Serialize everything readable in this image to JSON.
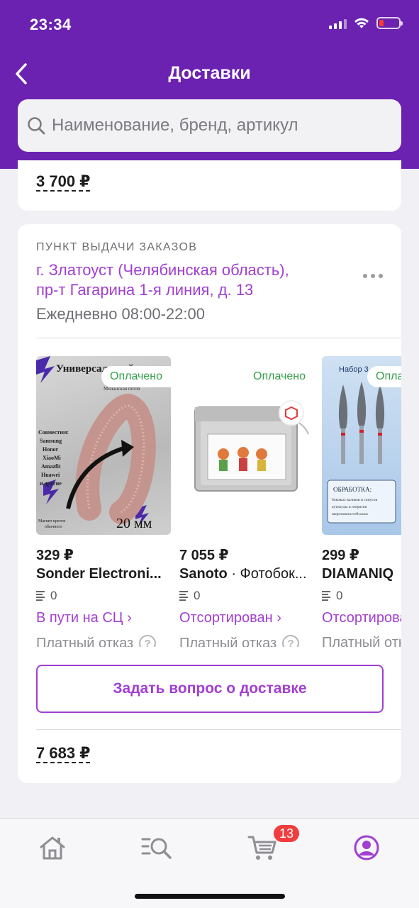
{
  "status_bar": {
    "time": "23:34"
  },
  "header": {
    "title": "Доставки",
    "search_placeholder": "Наименование, бренд, артикул"
  },
  "previous_order": {
    "total": "3 700 ₽"
  },
  "delivery": {
    "pickup_label": "ПУНКТ ВЫДАЧИ ЗАКАЗОВ",
    "address_line1": "г. Златоуст (Челябинская область),",
    "address_line2": "пр-т Гагарина 1-я линия, д. 13",
    "hours": "Ежедневно 08:00-22:00",
    "products": [
      {
        "paid_badge": "Оплачено",
        "price": "329 ₽",
        "brand": "Sonder Electroni...",
        "name": "",
        "qty": "0",
        "status": "В пути на СЦ ›",
        "refusal": "Платный отказ",
        "image_text": {
          "top": "Универсальный ремешок",
          "sub": "Миланская петля",
          "compat": "Совместим: Samsung Honor XiaoMi Amazfit Huawei и другие",
          "magnet": "Магнит крепче обычного",
          "size": "20 мм"
        }
      },
      {
        "paid_badge": "Оплачено",
        "price": "7 055 ₽",
        "brand": "Sanoto",
        "name": " · Фотобок...",
        "qty": "0",
        "status": "Отсортирован ›",
        "refusal": "Платный отказ"
      },
      {
        "paid_badge": "Оплачено",
        "price": "299 ₽",
        "brand": "DIAMANIQ",
        "name": "",
        "qty": "0",
        "status": "Отсортирован ›",
        "refusal": "Платный отказ",
        "image_text": {
          "set": "Набор 3",
          "treat": "ОБРАБОТКА:",
          "desc": "боковых валиков и синусов · кутикулы и птеригия · шероховатостей кожи"
        }
      }
    ],
    "ask_button": "Задать вопрос о доставке",
    "total": "7 683 ₽"
  },
  "bottom_nav": {
    "items": [
      "home-icon",
      "catalog-search-icon",
      "cart-icon",
      "profile-icon"
    ],
    "cart_badge": "13",
    "active_color": "#a13fd1"
  },
  "colors": {
    "brand": "#6b22b0",
    "accent": "#a13fd1",
    "paid": "#35a04a"
  }
}
